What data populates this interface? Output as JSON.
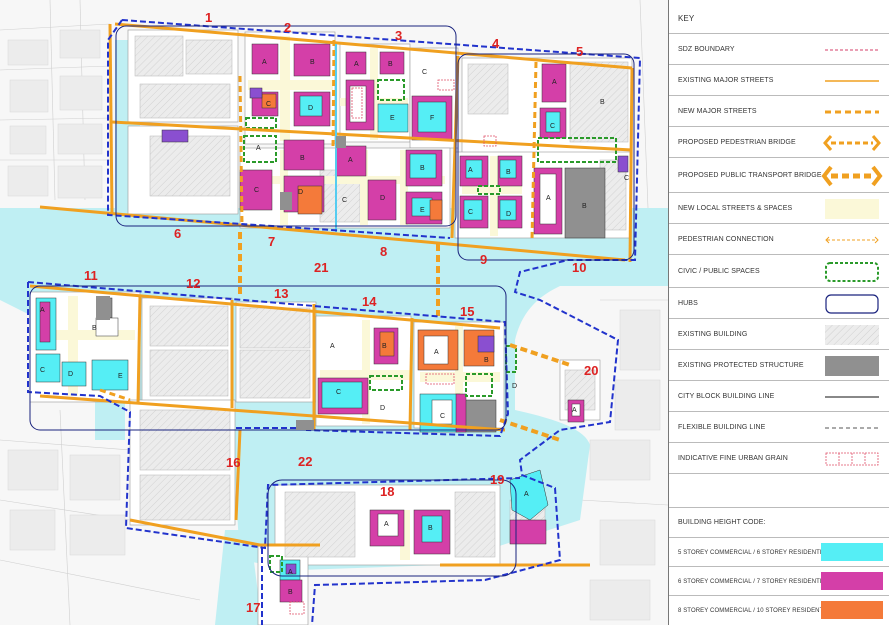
{
  "key": {
    "title": "KEY",
    "items": [
      {
        "label": "SDZ BOUNDARY",
        "symbol": "sdz-boundary-symbol"
      },
      {
        "label": "EXISTING MAJOR STREETS",
        "symbol": "major-street-symbol"
      },
      {
        "label": "NEW MAJOR STREETS",
        "symbol": "new-major-street-symbol"
      },
      {
        "label": "PROPOSED PEDESTRIAN BRIDGE",
        "symbol": "pedestrian-bridge-symbol"
      },
      {
        "label": "PROPOSED PUBLIC TRANSPORT BRIDGE",
        "symbol": "transport-bridge-symbol"
      },
      {
        "label": "NEW LOCAL STREETS & SPACES",
        "symbol": "local-streets-symbol"
      },
      {
        "label": "PEDESTRIAN CONNECTION",
        "symbol": "pedestrian-connection-symbol"
      },
      {
        "label": "CIVIC / PUBLIC SPACES",
        "symbol": "civic-space-symbol"
      },
      {
        "label": "HUBS",
        "symbol": "hub-symbol"
      },
      {
        "label": "EXISTING BUILDING",
        "symbol": "existing-building-symbol"
      },
      {
        "label": "EXISTING PROTECTED STRUCTURE",
        "symbol": "protected-structure-symbol"
      },
      {
        "label": "CITY BLOCK BUILDING LINE",
        "symbol": "building-line-symbol"
      },
      {
        "label": "FLEXIBLE BUILDING LINE",
        "symbol": "flexible-line-symbol"
      },
      {
        "label": "INDICATIVE FINE URBAN GRAIN",
        "symbol": "urban-grain-symbol"
      }
    ],
    "height_title": "BUILDING HEIGHT CODE:",
    "heights": [
      {
        "label": "5 STOREY COMMERCIAL / 6 STOREY RESIDENTIAL",
        "color": "#55eef5"
      },
      {
        "label": "6 STOREY COMMERCIAL / 7 STOREY RESIDENTIAL",
        "color": "#d43fa8"
      },
      {
        "label": "8 STOREY COMMERCIAL / 10 STOREY RESIDENTIAL",
        "color": "#f47a3a"
      }
    ]
  },
  "map": {
    "block_numbers": [
      "1",
      "2",
      "3",
      "4",
      "5",
      "6",
      "7",
      "8",
      "9",
      "10",
      "11",
      "12",
      "13",
      "14",
      "15",
      "16",
      "17",
      "18",
      "19",
      "20",
      "21",
      "22"
    ],
    "building_letters": [
      "A",
      "B",
      "C",
      "D",
      "E",
      "F"
    ],
    "colors": {
      "water": "#bfeff3",
      "sdz_boundary": "#2233cc",
      "major_street": "#f0a020",
      "civic": "#2a9a2a",
      "local_street": "#fbf8d8",
      "existing_building": "#e8e8e8",
      "protected": "#909090",
      "purple": "#8a4fd0"
    }
  }
}
